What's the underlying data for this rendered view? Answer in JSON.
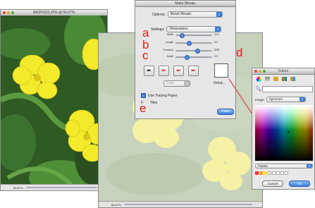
{
  "photo_window": {
    "title": "IMGP0322.JPG @ 66.67%",
    "zoom": "66.67%"
  },
  "back_window": {
    "zoom": "66.67%"
  },
  "dialog": {
    "title": "Make Mosaic",
    "options_label": "Options:",
    "options_value": "Reset Mosaic",
    "settings_label": "Settings:",
    "settings_value": "Dimensions",
    "sliders": [
      {
        "label": "Width",
        "value": "10.0",
        "level": 0.12
      },
      {
        "label": "Length",
        "value": "8.0",
        "level": 0.35
      },
      {
        "label": "Precision",
        "value": "SRR",
        "level": 0.6
      },
      {
        "label": "Detail",
        "value": "3.0",
        "level": 0.28
      }
    ],
    "color_label": "Color",
    "grout_label": "Grout...",
    "tracing_label": "Use Tracing Paper",
    "tracing_checked": true,
    "tiles_count": "0",
    "tiles_label": "Tiles",
    "done_label": "Done"
  },
  "annotations": {
    "a": "a",
    "b": "b",
    "c": "c",
    "d": "d",
    "e": "e"
  },
  "colors_panel": {
    "title": "Colors",
    "image_label": "Image:",
    "image_value": "Spectrum",
    "palette_value": "Palette",
    "cancel_label": "Cancel",
    "ok_label": "OK"
  },
  "accent_colors": {
    "annotation": "#e02020",
    "button_blue": "#3a7fde",
    "flower_yellow": "#f3ea2c"
  }
}
